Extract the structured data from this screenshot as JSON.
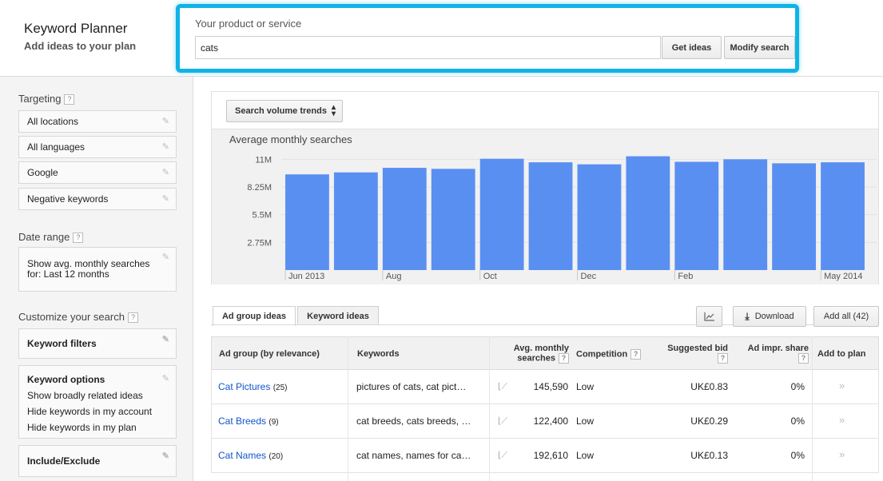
{
  "header": {
    "title": "Keyword Planner",
    "subtitle": "Add ideas to your plan",
    "search_label": "Your product or service",
    "search_value": "cats",
    "get_ideas": "Get ideas",
    "modify_search": "Modify search"
  },
  "sidebar": {
    "targeting_label": "Targeting",
    "targeting_items": [
      "All locations",
      "All languages",
      "Google",
      "Negative keywords"
    ],
    "date_range_label": "Date range",
    "date_range_value": "Show avg. monthly searches for: Last 12 months",
    "customize_label": "Customize your search",
    "keyword_filters": "Keyword filters",
    "keyword_options_title": "Keyword options",
    "keyword_options": [
      "Show broadly related ideas",
      "Hide keywords in my account",
      "Hide keywords in my plan"
    ],
    "include_exclude": "Include/Exclude",
    "help": "?"
  },
  "chart_panel": {
    "trend_button": "Search volume trends",
    "trend_button_icon": "sort-arrows-icon"
  },
  "chart_data": {
    "type": "bar",
    "title": "Average monthly searches",
    "categories": [
      "Jun 2013",
      "Jul 2013",
      "Aug 2013",
      "Sep 2013",
      "Oct 2013",
      "Nov 2013",
      "Dec 2013",
      "Jan 2014",
      "Feb 2014",
      "Mar 2014",
      "Apr 2014",
      "May 2014"
    ],
    "x_tick_labels": [
      "Jun 2013",
      "",
      "Aug",
      "",
      "Oct",
      "",
      "Dec",
      "",
      "Feb",
      "",
      "",
      "May 2014"
    ],
    "values": [
      9500000,
      9700000,
      10150000,
      10050000,
      11050000,
      10700000,
      10500000,
      11300000,
      10750000,
      11000000,
      10600000,
      10700000
    ],
    "y_ticks": [
      "2.75M",
      "5.5M",
      "8.25M",
      "11M"
    ],
    "ylim": [
      0,
      11900000
    ],
    "bar_color": "#5a8ff2",
    "grid": true
  },
  "tabs": {
    "ad_group": "Ad group ideas",
    "keyword": "Keyword ideas"
  },
  "toolbar": {
    "chart_icon": "line-chart-icon",
    "download": "Download",
    "download_icon": "download-icon",
    "add_all": "Add all (42)"
  },
  "table": {
    "headers": {
      "ad_group": "Ad group (by relevance)",
      "keywords": "Keywords",
      "avg_line1": "Avg. monthly",
      "avg_line2": "searches",
      "competition": "Competition",
      "bid_line1": "Suggested bid",
      "share_line1": "Ad impr. share",
      "add": "Add to plan",
      "help": "?"
    },
    "rows": [
      {
        "name": "Cat Pictures",
        "count": "(25)",
        "keywords": "pictures of cats, cat pict…",
        "searches": "145,590",
        "competition": "Low",
        "bid": "UK£0.83",
        "share": "0%",
        "add": "»"
      },
      {
        "name": "Cat Breeds",
        "count": "(9)",
        "keywords": "cat breeds, cats breeds, …",
        "searches": "122,400",
        "competition": "Low",
        "bid": "UK£0.29",
        "share": "0%",
        "add": "»"
      },
      {
        "name": "Cat Names",
        "count": "(20)",
        "keywords": "cat names, names for ca…",
        "searches": "192,610",
        "competition": "Low",
        "bid": "UK£0.13",
        "share": "0%",
        "add": "»"
      }
    ]
  }
}
